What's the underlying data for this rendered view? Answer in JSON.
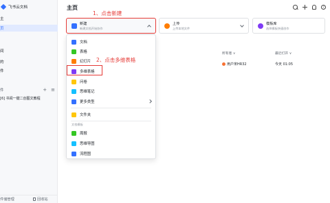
{
  "app": {
    "name": "飞书云文档"
  },
  "sidebar": {
    "items": [
      {
        "label": "页"
      },
      {
        "label": ""
      },
      {
        "label": ""
      },
      {
        "label": "间"
      },
      {
        "label": "的"
      },
      {
        "label": ""
      },
      {
        "label": ""
      },
      {
        "label": ""
      }
    ],
    "texts": [
      "主",
      "页",
      "文档",
      "间",
      "的",
      "件"
    ],
    "active_index": 0,
    "section_label": "件",
    "shortcut_item": "[6] 书阅一键二创图文教程",
    "footer_left": "件储管理",
    "footer_right": "回收站"
  },
  "header": {
    "title": "主页"
  },
  "cards": {
    "new": {
      "title": "新建",
      "subtitle": "新建文档开始协作"
    },
    "upload": {
      "title": "上传",
      "subtitle": "上传本地文件"
    },
    "template": {
      "title": "模板库",
      "subtitle": "选择模板快速创作"
    }
  },
  "annotations": {
    "step1": "1、点击新建",
    "step2": "2、点击多维表格"
  },
  "list": {
    "col_owner": "所有者 ∨",
    "col_time": "最近打开 ∨",
    "row": {
      "owner": "用户宋HR32",
      "time": "今天 01:05"
    }
  },
  "menu": {
    "items": [
      {
        "label": "文档",
        "icon": "doc-icon",
        "color": "#3370ff"
      },
      {
        "label": "表格",
        "icon": "sheet-icon",
        "color": "#34c724"
      },
      {
        "label": "幻灯片",
        "icon": "slides-icon",
        "color": "#ff7d00"
      },
      {
        "label": "多维表格",
        "icon": "base-icon",
        "color": "#7f3bf5"
      },
      {
        "label": "问卷",
        "icon": "form-icon",
        "color": "#ffc60a"
      },
      {
        "label": "思维笔记",
        "icon": "mindnote-icon",
        "color": "#14c0ff"
      },
      {
        "label": "更多类型",
        "icon": "more-icon",
        "color": "#3370ff"
      }
    ],
    "folder": {
      "label": "文件夹",
      "icon": "folder-icon",
      "color": "#ffc60a"
    },
    "section_title": "文档模板",
    "templates": [
      {
        "label": "周报",
        "icon": "weekly-icon",
        "color": "#34c724"
      },
      {
        "label": "思维导图",
        "icon": "mindmap-icon",
        "color": "#14c0ff"
      },
      {
        "label": "流程图",
        "icon": "flow-icon",
        "color": "#3370ff"
      }
    ]
  },
  "colors": {
    "accent": "#3370ff",
    "annotation": "#e53935"
  }
}
